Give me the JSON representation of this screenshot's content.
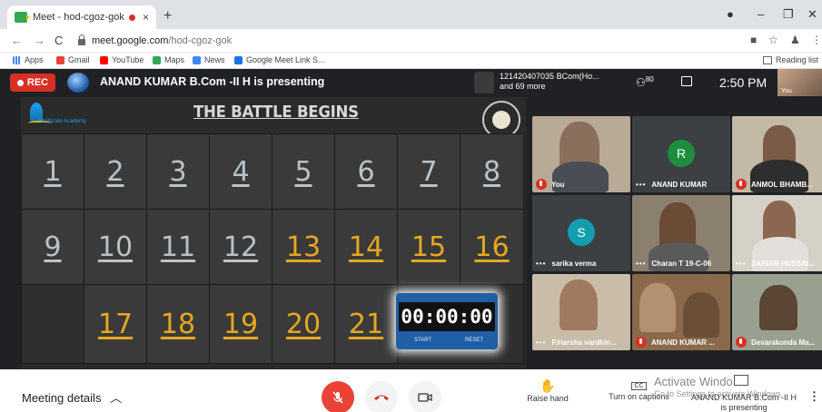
{
  "browser": {
    "tab_title": "Meet - hod-cgoz-gok",
    "tab_close": "×",
    "new_tab": "+",
    "url_host": "meet.google.com",
    "url_path": "/hod-cgoz-gok",
    "bookmarks": [
      "Apps",
      "Gmail",
      "YouTube",
      "Maps",
      "News",
      "Google Meet Link S..."
    ],
    "reading_list": "Reading list",
    "colors": {
      "gmail": "#ea4335",
      "youtube": "#ff0000",
      "maps": "#34a853",
      "news": "#4285f4",
      "meet": "#1a73e8",
      "apps": "#4285f4"
    }
  },
  "meet": {
    "rec_label": "REC",
    "presenting_text": "ANAND KUMAR B.Com -II H is presenting",
    "presenter_info_line1": "121420407035 BCom(Ho...",
    "presenter_info_line2": "and 69 more",
    "people_count": "80",
    "time": "2:50 PM",
    "self_label": "You",
    "slide": {
      "title": "THE BATTLE BEGINS",
      "logo_text": "Skillstride Academy",
      "numbers_white": [
        "1",
        "2",
        "3",
        "4",
        "5",
        "6",
        "7",
        "8",
        "9",
        "10",
        "11",
        "12"
      ],
      "numbers_yellow": [
        "13",
        "14",
        "15",
        "16",
        "17",
        "18",
        "19",
        "20",
        "21"
      ],
      "timer": "00:00:00",
      "timer_start": "START",
      "timer_reset": "RESET"
    },
    "tiles": [
      {
        "name": "You",
        "type": "video",
        "muted": true
      },
      {
        "name": "ANAND KUMAR",
        "type": "avatar",
        "letter": "R",
        "avatar_color": "#1e8e3e",
        "muted": false
      },
      {
        "name": "ANMOL BHAMB...",
        "type": "video",
        "muted": true
      },
      {
        "name": "sarika verma",
        "type": "avatar",
        "letter": "S",
        "avatar_color": "#129eaf",
        "muted": false
      },
      {
        "name": "Charan T 19-C-06",
        "type": "video",
        "muted": false
      },
      {
        "name": "ZAINAB HUSSAI...",
        "type": "video",
        "muted": false
      },
      {
        "name": "P.Harsha vardhin...",
        "type": "video",
        "muted": false
      },
      {
        "name": "ANAND KUMAR ...",
        "type": "video",
        "muted": true
      },
      {
        "name": "Devarakonda Ma...",
        "type": "video",
        "muted": true
      }
    ],
    "bottom": {
      "meeting_details": "Meeting details",
      "raise_hand": "Raise hand",
      "captions": "Turn on captions",
      "cc": "CC",
      "activate_line1": "Activate Windo",
      "activate_line2": "Go to Settings to activate Windows.",
      "presenter_name": "ANAND KUMAR B.Com -II H",
      "presenter_status": "is presenting"
    }
  }
}
